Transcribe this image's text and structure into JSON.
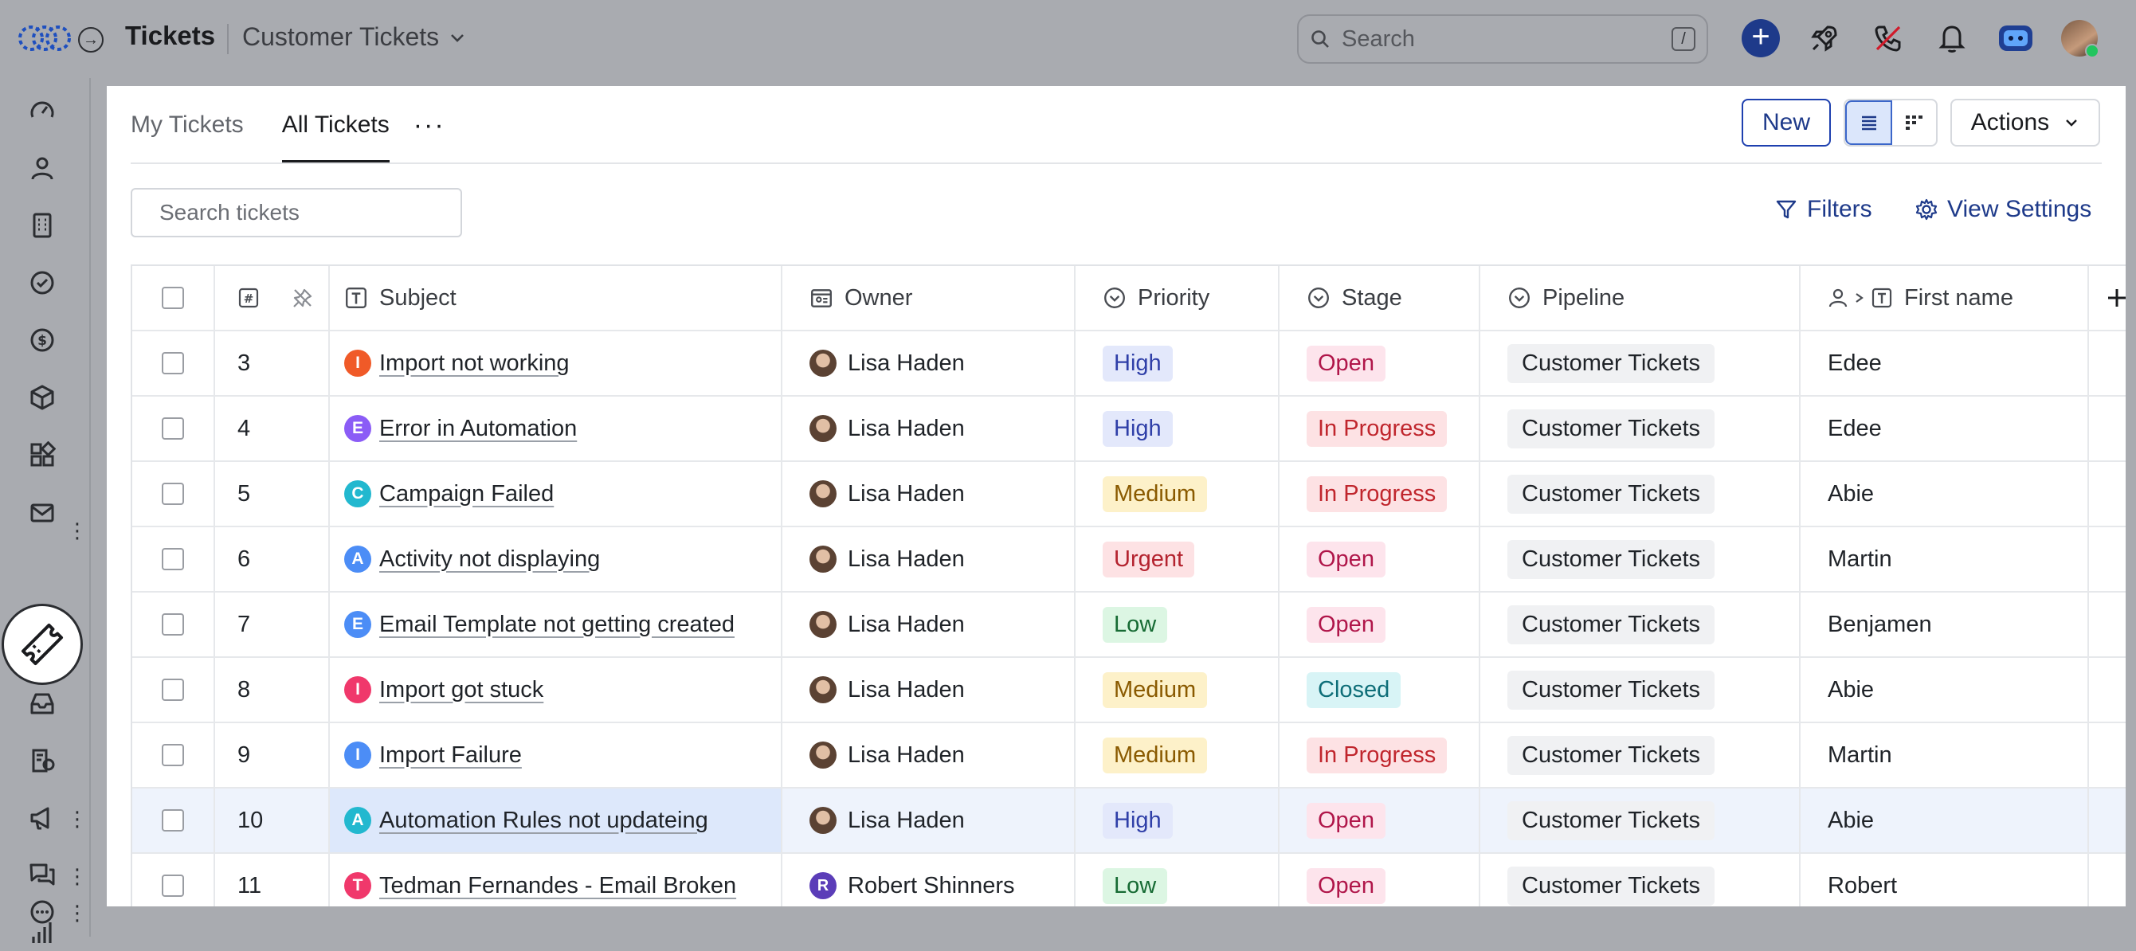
{
  "header": {
    "app_title": "Tickets",
    "breadcrumb": "Customer Tickets",
    "search_placeholder": "Search",
    "search_shortcut": "/"
  },
  "tabs": [
    {
      "label": "My Tickets",
      "active": false
    },
    {
      "label": "All Tickets",
      "active": true
    }
  ],
  "toolbar": {
    "new_label": "New",
    "actions_label": "Actions",
    "search_placeholder": "Search tickets",
    "filters_label": "Filters",
    "view_settings_label": "View Settings"
  },
  "table": {
    "columns": {
      "subject": "Subject",
      "owner": "Owner",
      "priority": "Priority",
      "stage": "Stage",
      "pipeline": "Pipeline",
      "first_name": "First name"
    },
    "rows": [
      {
        "num": "3",
        "badge": "I",
        "badge_color": "#f05a28",
        "subject": "Import not working",
        "owner": "Lisa Haden",
        "owner_letter": "",
        "priority": "High",
        "stage": "Open",
        "pipeline": "Customer Tickets",
        "first_name": "Edee"
      },
      {
        "num": "4",
        "badge": "E",
        "badge_color": "#8b5cf6",
        "subject": "Error in Automation",
        "owner": "Lisa Haden",
        "owner_letter": "",
        "priority": "High",
        "stage": "In Progress",
        "pipeline": "Customer Tickets",
        "first_name": "Edee"
      },
      {
        "num": "5",
        "badge": "C",
        "badge_color": "#22b8cf",
        "subject": "Campaign Failed",
        "owner": "Lisa Haden",
        "owner_letter": "",
        "priority": "Medium",
        "stage": "In Progress",
        "pipeline": "Customer Tickets",
        "first_name": "Abie"
      },
      {
        "num": "6",
        "badge": "A",
        "badge_color": "#4c8df6",
        "subject": "Activity not displaying",
        "owner": "Lisa Haden",
        "owner_letter": "",
        "priority": "Urgent",
        "stage": "Open",
        "pipeline": "Customer Tickets",
        "first_name": "Martin"
      },
      {
        "num": "7",
        "badge": "E",
        "badge_color": "#4c8df6",
        "subject": "Email Template not getting created",
        "owner": "Lisa Haden",
        "owner_letter": "",
        "priority": "Low",
        "stage": "Open",
        "pipeline": "Customer Tickets",
        "first_name": "Benjamen"
      },
      {
        "num": "8",
        "badge": "I",
        "badge_color": "#f0386b",
        "subject": "Import got stuck",
        "owner": "Lisa Haden",
        "owner_letter": "",
        "priority": "Medium",
        "stage": "Closed",
        "pipeline": "Customer Tickets",
        "first_name": "Abie"
      },
      {
        "num": "9",
        "badge": "I",
        "badge_color": "#4c8df6",
        "subject": "Import Failure",
        "owner": "Lisa Haden",
        "owner_letter": "",
        "priority": "Medium",
        "stage": "In Progress",
        "pipeline": "Customer Tickets",
        "first_name": "Martin"
      },
      {
        "num": "10",
        "badge": "A",
        "badge_color": "#22b8cf",
        "subject": "Automation Rules not updateing",
        "owner": "Lisa Haden",
        "owner_letter": "",
        "priority": "High",
        "stage": "Open",
        "pipeline": "Customer Tickets",
        "first_name": "Abie",
        "highlight": true
      },
      {
        "num": "11",
        "badge": "T",
        "badge_color": "#f0386b",
        "subject": "Tedman Fernandes - Email Broken",
        "owner": "Robert Shinners",
        "owner_letter": "R",
        "priority": "Low",
        "stage": "Open",
        "pipeline": "Customer Tickets",
        "first_name": "Robert"
      }
    ]
  },
  "colors": {
    "priority": {
      "High": {
        "bg": "#e3e8fb",
        "fg": "#2f3fa8"
      },
      "Medium": {
        "bg": "#fdf1c9",
        "fg": "#8a5a00"
      },
      "Urgent": {
        "bg": "#fde2e4",
        "fg": "#b4232f"
      },
      "Low": {
        "bg": "#dcf6e3",
        "fg": "#176b34"
      }
    },
    "stage": {
      "Open": {
        "bg": "#fde4ec",
        "fg": "#b0164a"
      },
      "In Progress": {
        "bg": "#fde2e4",
        "fg": "#c0262d"
      },
      "Closed": {
        "bg": "#d8f4f6",
        "fg": "#0e6e78"
      }
    }
  }
}
